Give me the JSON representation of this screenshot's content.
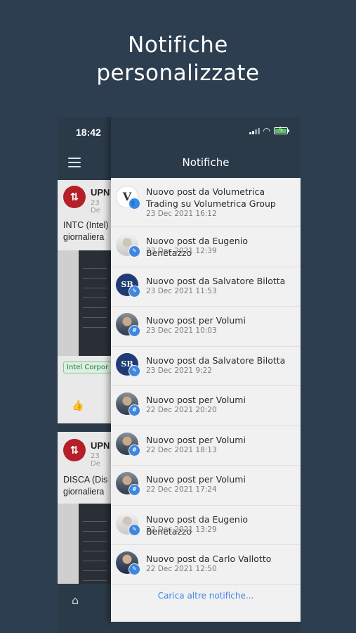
{
  "promo": {
    "line1": "Notifiche",
    "line2": "personalizzate"
  },
  "status_bar": {
    "time": "18:42"
  },
  "drawer": {
    "title": "Notifiche",
    "load_more": "Carica altre notifiche..."
  },
  "notifications": [
    {
      "title": "Nuovo post da Volumetrica Trading su Volumetrica Group",
      "date": "23 Dec 2021 16:12",
      "avatar": "V",
      "badge_icon": "group-icon"
    },
    {
      "title": "Nuovo post da Eugenio Benetazzo",
      "date": "23 Dec 2021 12:39",
      "badge_icon": "post-icon"
    },
    {
      "title": "Nuovo post da Salvatore Bilotta",
      "date": "23 Dec 2021 11:53",
      "avatar": "SB",
      "badge_icon": "post-icon"
    },
    {
      "title": "Nuovo post per Volumi",
      "date": "23 Dec 2021 10:03",
      "badge_icon": "hashtag-icon"
    },
    {
      "title": "Nuovo post da Salvatore Bilotta",
      "date": "23 Dec 2021 9:22",
      "avatar": "SB",
      "badge_icon": "post-icon"
    },
    {
      "title": "Nuovo post per Volumi",
      "date": "22 Dec 2021 20:20",
      "badge_icon": "hashtag-icon"
    },
    {
      "title": "Nuovo post per Volumi",
      "date": "22 Dec 2021 18:13",
      "badge_icon": "hashtag-icon"
    },
    {
      "title": "Nuovo post per Volumi",
      "date": "22 Dec 2021 17:24",
      "badge_icon": "hashtag-icon"
    },
    {
      "title": "Nuovo post da Eugenio Benetazzo",
      "date": "22 Dec 2021 13:29",
      "badge_icon": "post-icon"
    },
    {
      "title": "Nuovo post da Carlo Vallotto",
      "date": "22 Dec 2021 12:50",
      "badge_icon": "post-icon"
    }
  ],
  "background_feed": {
    "cards": [
      {
        "name": "UPN",
        "date": "23 De",
        "text1": "INTC (Intel)",
        "text2": "giornaliera",
        "tag": "Intel Corpor"
      },
      {
        "name": "UPN",
        "date": "23 De",
        "text1": "DISCA (Dis",
        "text2": "giornaliera"
      }
    ]
  },
  "colors": {
    "background": "#2d3e50",
    "header": "#2b3a49",
    "accent": "#3f86e0",
    "brand_logo": "#b51f28"
  }
}
